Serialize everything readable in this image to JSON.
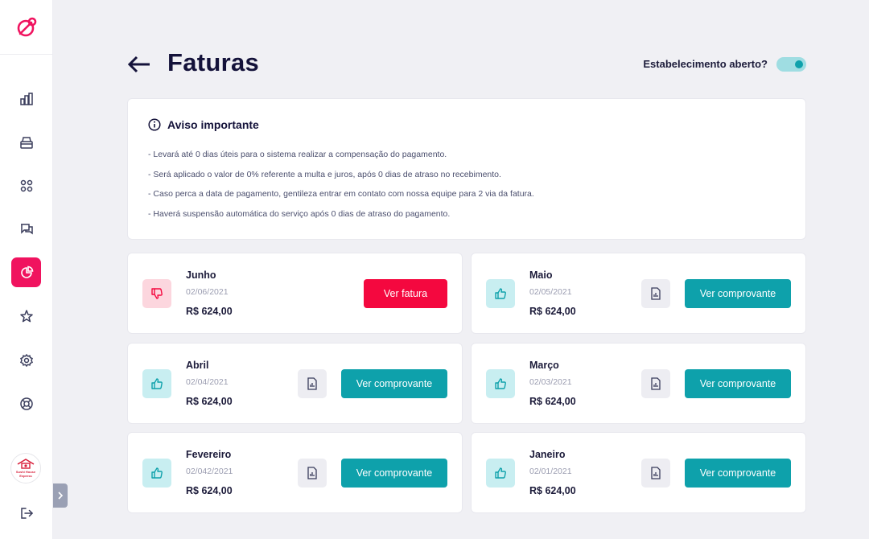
{
  "app": {
    "accent": "#f0135f",
    "teal": "#0ea1ab"
  },
  "sidebar": {
    "logo_icon": "pin-logo-icon",
    "items": [
      {
        "name": "dashboard",
        "icon": "bar-chart-icon"
      },
      {
        "name": "orders",
        "icon": "box-icon"
      },
      {
        "name": "catalog",
        "icon": "grid-icon"
      },
      {
        "name": "chat",
        "icon": "chat-icon"
      },
      {
        "name": "finance",
        "icon": "pie-chart-icon",
        "active": true
      },
      {
        "name": "reviews",
        "icon": "star-icon"
      },
      {
        "name": "settings",
        "icon": "gear-icon"
      },
      {
        "name": "support",
        "icon": "lifebuoy-icon"
      }
    ],
    "store_avatar_text": "Sushi House Express",
    "logout_icon": "logout-icon"
  },
  "header": {
    "title": "Faturas",
    "open_label": "Estabelecimento aberto?",
    "open_toggle": true
  },
  "notice": {
    "title": "Aviso importante",
    "lines": [
      "- Levará até 0 dias úteis para o sistema realizar a compensação do pagamento.",
      "- Será aplicado o valor de 0% referente a multa e juros, após 0 dias de atraso no recebimento.",
      "- Caso perca a data de pagamento, gentileza entrar em contato com nossa equipe para 2 via da fatura.",
      "- Haverá suspensão automática do serviço após 0 dias de atraso do pagamento."
    ]
  },
  "invoices": [
    {
      "month": "Junho",
      "date": "02/06/2021",
      "amount": "R$ 624,00",
      "status": "unpaid",
      "button": "Ver fatura"
    },
    {
      "month": "Maio",
      "date": "02/05/2021",
      "amount": "R$ 624,00",
      "status": "paid",
      "button": "Ver comprovante"
    },
    {
      "month": "Abril",
      "date": "02/04/2021",
      "amount": "R$ 624,00",
      "status": "paid",
      "button": "Ver comprovante"
    },
    {
      "month": "Março",
      "date": "02/03/2021",
      "amount": "R$ 624,00",
      "status": "paid",
      "button": "Ver comprovante"
    },
    {
      "month": "Fevereiro",
      "date": "02/042/2021",
      "amount": "R$ 624,00",
      "status": "paid",
      "button": "Ver comprovante"
    },
    {
      "month": "Janeiro",
      "date": "02/01/2021",
      "amount": "R$ 624,00",
      "status": "paid",
      "button": "Ver comprovante"
    }
  ]
}
